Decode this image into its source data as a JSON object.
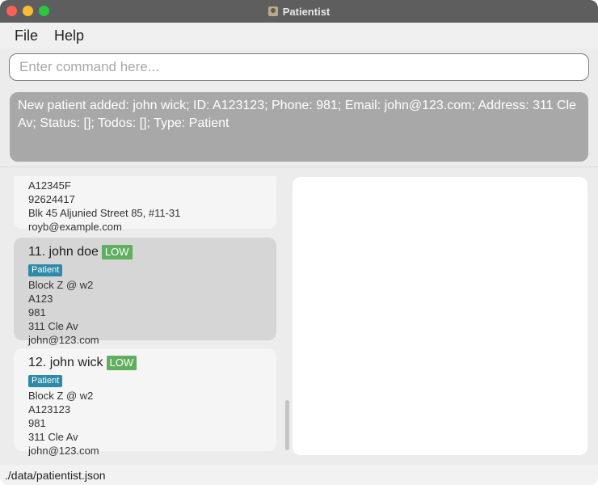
{
  "window": {
    "title": "Patientist"
  },
  "menu": {
    "items": [
      {
        "label": "File"
      },
      {
        "label": "Help"
      }
    ]
  },
  "command": {
    "placeholder": "Enter command here...",
    "value": ""
  },
  "result": {
    "text": "New patient added: john wick; ID: A123123; Phone: 981; Email: john@123.com; Address: 311 Cle Av; Status: []; Todos: []; Type: Patient"
  },
  "patients": {
    "partial": {
      "id": "A12345F",
      "phone": "92624417",
      "address": "Blk 45 Aljunied Street 85, #11-31",
      "email": "royb@example.com"
    },
    "items": [
      {
        "header": "11.  john doe",
        "priority": "LOW",
        "type": "Patient",
        "ward": "Block Z @ w2",
        "id": "A123",
        "phone": "981",
        "address": "311 Cle Av",
        "email": "john@123.com",
        "selected": true
      },
      {
        "header": "12.  john wick",
        "priority": "LOW",
        "type": "Patient",
        "ward": "Block Z @ w2",
        "id": "A123123",
        "phone": "981",
        "address": "311 Cle Av",
        "email": "john@123.com",
        "selected": false
      }
    ]
  },
  "statusbar": {
    "path": "./data/patientist.json"
  },
  "colors": {
    "titlebar": "#5e5e5e",
    "priority_low": "#5faf5f",
    "tag": "#2d8aa8",
    "result_bg": "#a8a8a8",
    "selected_card": "#d6d6d6"
  }
}
